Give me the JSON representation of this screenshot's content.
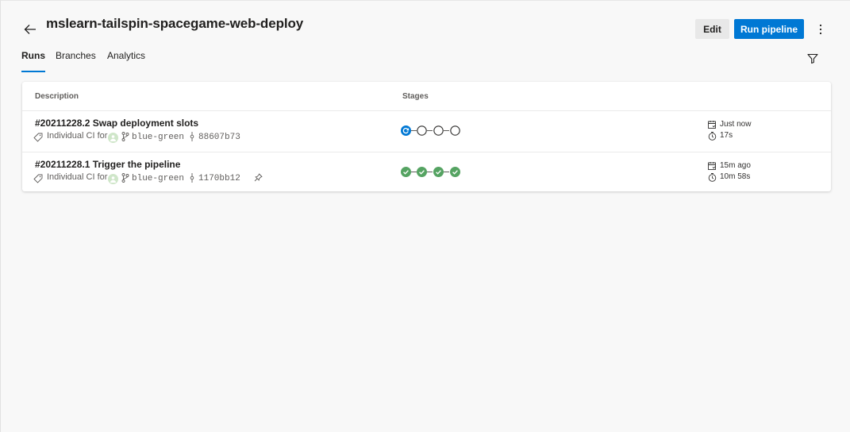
{
  "header": {
    "title": "mslearn-tailspin-spacegame-web-deploy",
    "edit_label": "Edit",
    "run_label": "Run pipeline"
  },
  "tabs": [
    {
      "label": "Runs",
      "active": true
    },
    {
      "label": "Branches",
      "active": false
    },
    {
      "label": "Analytics",
      "active": false
    }
  ],
  "table": {
    "columns": {
      "description": "Description",
      "stages": "Stages"
    },
    "rows": [
      {
        "title": "#20211228.2 Swap deployment slots",
        "trigger": "Individual CI for",
        "branch": "blue-green",
        "commit": "88607b73",
        "stages": [
          "running",
          "pending",
          "pending",
          "pending"
        ],
        "queued": "Just now",
        "duration": "17s",
        "pinned": false
      },
      {
        "title": "#20211228.1 Trigger the pipeline",
        "trigger": "Individual CI for",
        "branch": "blue-green",
        "commit": "1170bb12",
        "stages": [
          "succeeded",
          "succeeded",
          "succeeded",
          "succeeded"
        ],
        "queued": "15m ago",
        "duration": "10m 58s",
        "pinned": true
      }
    ]
  },
  "icons": {
    "back": "arrow-left-icon",
    "more": "more-vertical-icon",
    "filter": "filter-icon",
    "tag": "tag-icon",
    "branch": "branch-icon",
    "commit": "commit-icon",
    "calendar": "calendar-icon",
    "clock": "clock-icon",
    "pin": "pin-icon"
  },
  "colors": {
    "accent": "#0078d4",
    "success": "#55a362",
    "running": "#0078d4",
    "pending": "#605e5c"
  }
}
